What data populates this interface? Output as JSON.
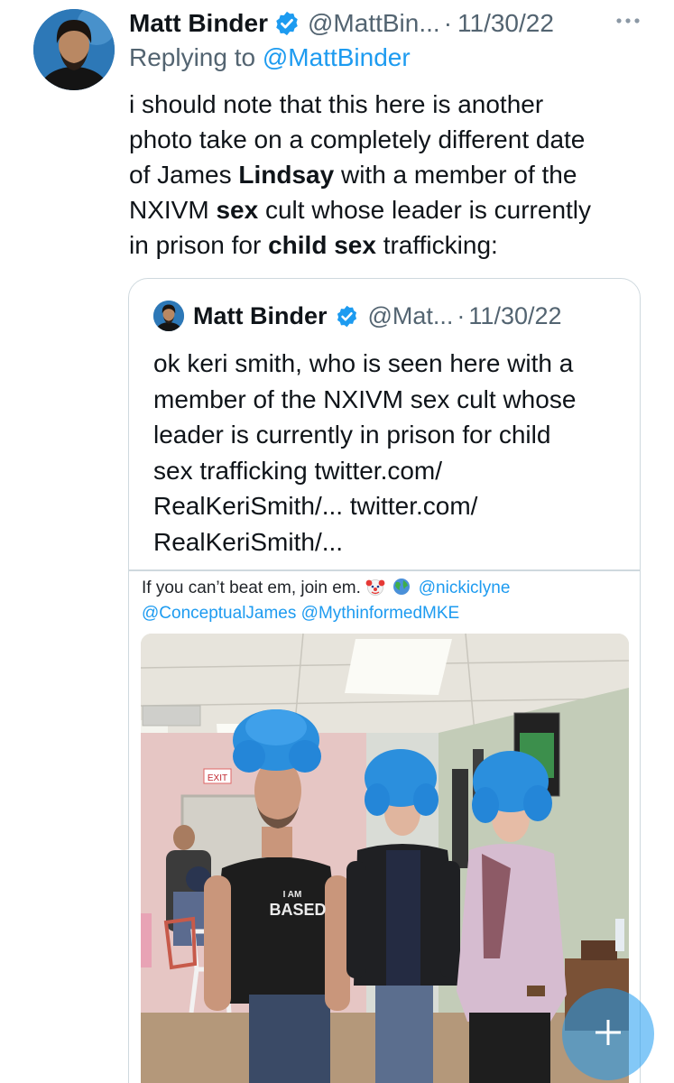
{
  "tweet": {
    "author_name": "Matt Binder",
    "handle": "@MattBin...",
    "separator": "·",
    "date": "11/30/22",
    "replying_prefix": "Replying to ",
    "replying_to": "@MattBinder",
    "text_lines": [
      [
        "i should note that this here is another"
      ],
      [
        "photo take on a completely different date"
      ],
      [
        "of James ",
        "Lindsay",
        " with a member of the"
      ],
      [
        "NXIVM ",
        "sex",
        " cult whose leader is currently"
      ],
      [
        "in prison for ",
        "child sex",
        " trafficking:"
      ]
    ]
  },
  "quoted_tweet": {
    "author_name": "Matt Binder",
    "handle": "@Mat...",
    "separator": "·",
    "date": "11/30/22",
    "text_lines": [
      "ok keri smith, who is seen here with a",
      "member of the NXIVM sex cult whose",
      "leader is currently in prison for child",
      "sex trafficking twitter.com/",
      "RealKeriSmith/... twitter.com/",
      "RealKeriSmith/..."
    ]
  },
  "embedded_screenshot": {
    "caption_text": "If you can’t beat em, join em. ",
    "caption_handle_1": "@nickiclyne",
    "caption_handle_2": "@ConceptualJames",
    "caption_handle_3": "@MythinformedMKE",
    "photo_shirt_text_1": "I AM",
    "photo_shirt_text_2": "BASED",
    "photo_exit_sign": "EXIT"
  },
  "icons": {
    "verified": "verified-badge-icon",
    "more": "more-options-icon",
    "compose": "compose-plus-icon"
  },
  "colors": {
    "link": "#1d9bf0",
    "secondary_text": "#536471",
    "primary_text": "#0f1419",
    "border": "#cfd9de"
  }
}
